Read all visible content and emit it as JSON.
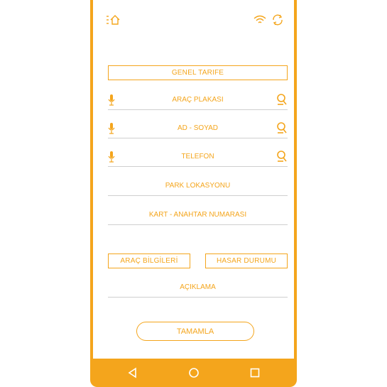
{
  "form": {
    "tariff_label": "GENEL TARIFE",
    "plate_label": "ARAÇ PLAKASI",
    "name_label": "AD - SOYAD",
    "phone_label": "TELEFON",
    "park_location_label": "PARK LOKASYONU",
    "key_number_label": "KART - ANAHTAR NUMARASI",
    "vehicle_info_button": "ARAÇ BİLGİLERİ",
    "damage_status_button": "HASAR DURUMU",
    "description_label": "AÇIKLAMA",
    "complete_button": "TAMAMLA"
  },
  "icons": {
    "status_left": "home-list-icon",
    "wifi": "wifi-icon",
    "sync": "sync-icon",
    "mic": "microphone-icon",
    "search": "search-person-icon",
    "nav_back": "back-triangle-icon",
    "nav_home": "home-circle-icon",
    "nav_recent": "recent-square-icon"
  },
  "colors": {
    "accent": "#f4a51c",
    "divider": "#cfcfcf",
    "background": "#ffffff"
  }
}
